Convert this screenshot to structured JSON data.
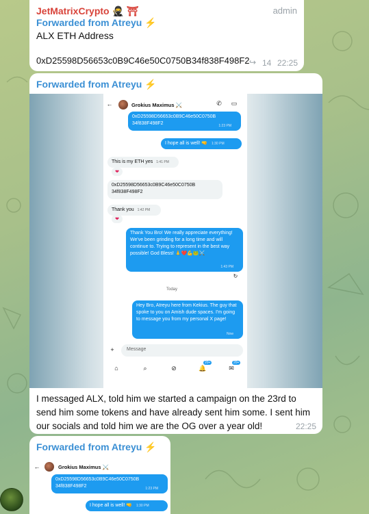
{
  "messages": [
    {
      "sender": "JetMatrixCrypto 🥷 ⛩",
      "role": "admin",
      "forwarded": "Forwarded from Atreyu ⚡",
      "lines": [
        "ALX ETH Address",
        "0xD25598D56653c0B9C46e50C0750B34f838F498F2"
      ],
      "views": "14",
      "time": "22:25"
    },
    {
      "forwarded": "Forwarded from Atreyu ⚡",
      "caption": "I messaged ALX, told him we started a campaign on the 23rd to send him some tokens and have already sent him some. I sent him our socials and told him we are the OG over a year old!",
      "time": "22:25"
    },
    {
      "forwarded": "Forwarded from Atreyu ⚡"
    }
  ],
  "dm": {
    "contact": "Grokius Maximus ⚔️",
    "address_bubble": "0xD25598D56653c0B9C46e50C0750B\n34f838F498F2",
    "address_time": "1:23 PM",
    "hope": "I hope all is well! 🤜",
    "hope_time": "1:30 PM",
    "eth_msg": "This is my ETH yes",
    "eth_time": "1:41 PM",
    "heart": "❤",
    "address_reply": "0xD25598D56653c0B9C46e50C0750B\n34f838F498F2",
    "thanks": "Thank you",
    "thanks_time": "1:42 PM",
    "long_reply": "Thank You Bro! We really appreciate everything! We've been grinding for a long time and will continue to. Trying to represent in the best way possible! God Bless! 🙏❤️💪🐸⚔️",
    "long_time": "1:43 PM",
    "today": "Today",
    "intro": "Hey Bro, Atreyu here from Kekius. The guy that spoke to you on Amish dude spaces. I'm going to message you from my personal X page!",
    "intro_time": "Now",
    "input_placeholder": "Message",
    "badge1": "20+",
    "badge2": "20+"
  },
  "colors": {
    "sender": "#d8433a",
    "forward": "#3a8fd4",
    "x_blue": "#1d9bf0"
  }
}
